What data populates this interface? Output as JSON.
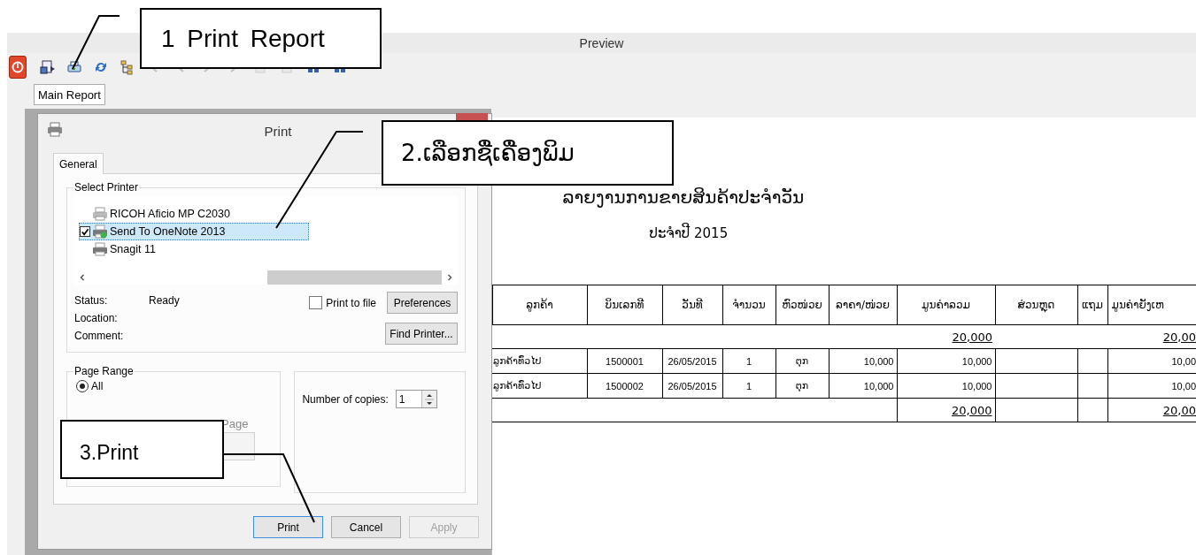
{
  "window": {
    "title": "Preview"
  },
  "toolbar": [
    {
      "kind": "power",
      "disabled": false
    },
    {
      "kind": "export",
      "disabled": false
    },
    {
      "kind": "print",
      "disabled": false
    },
    {
      "kind": "refresh",
      "disabled": false
    },
    {
      "kind": "tree",
      "disabled": false
    },
    {
      "kind": "first",
      "disabled": true
    },
    {
      "kind": "prev",
      "disabled": true
    },
    {
      "kind": "next",
      "disabled": true
    },
    {
      "kind": "last",
      "disabled": true
    },
    {
      "kind": "page",
      "disabled": true
    },
    {
      "kind": "page",
      "disabled": true
    },
    {
      "kind": "columns",
      "disabled": false
    },
    {
      "kind": "columns",
      "disabled": false
    }
  ],
  "report_tabs": [
    {
      "label": "Main Report",
      "selected": true
    }
  ],
  "print_dialog": {
    "title": "Print",
    "tabs": [
      {
        "label": "General",
        "selected": true
      }
    ],
    "select_printer": {
      "legend": "Select Printer",
      "printers": [
        {
          "name": "RICOH Aficio MP C2030",
          "selected": false,
          "default": false
        },
        {
          "name": "Send To OneNote 2013",
          "selected": true,
          "default": true
        },
        {
          "name": "Snagit 11",
          "selected": false,
          "default": false
        }
      ],
      "status_label": "Status:",
      "status": "Ready",
      "location_label": "Location:",
      "comment_label": "Comment:",
      "print_to_file": {
        "label": "Print to file",
        "checked": false
      },
      "preferences_button": "Preferences",
      "find_printer_button": "Find Printer..."
    },
    "page_range": {
      "legend": "Page Range",
      "all": {
        "label": "All",
        "selected": true
      },
      "hidden_option": {
        "label": "Page",
        "disabled": true
      }
    },
    "copies": {
      "label": "Number of copies:",
      "value": "1"
    },
    "buttons": [
      {
        "label": "Print",
        "kind": "default",
        "disabled": false
      },
      {
        "label": "Cancel",
        "kind": "normal",
        "disabled": false
      },
      {
        "label": "Apply",
        "kind": "normal",
        "disabled": true
      }
    ]
  },
  "report": {
    "title": "ລາຍງານການຂາຍສິນຄ້າປະຈຳວັນ",
    "subtitle": "ປະຈຳປີ 2015",
    "columns": [
      "ລູກຄ້າ",
      "ບິນເລກທີ",
      "ວັນທີ",
      "ຈຳນວນ",
      "ຫົວໜ່ວຍ",
      "ລາຄາ/ໜ່ວຍ",
      "ມູນຄ່າລວມ",
      "ສ່ວນຫຼຸດ",
      "ແຖມ",
      "ມູນຄ່າຍັງເຫ"
    ],
    "subtotal": {
      "amount": "20,000",
      "balance": "20,00"
    },
    "rows": [
      [
        "ລູກຄ້າທົ່ວໄປ",
        "1500001",
        "26/05/2015",
        "1",
        "ຕຸກ",
        "10,000",
        "10,000",
        "",
        "",
        "10,00"
      ],
      [
        "ລູກຄ້າທົ່ວໄປ",
        "1500002",
        "26/05/2015",
        "1",
        "ຕຸກ",
        "10,000",
        "10,000",
        "",
        "",
        "10,00"
      ]
    ],
    "total": {
      "amount": "20,000",
      "balance": "20,00"
    }
  },
  "callouts": [
    {
      "text": "1 Print Report"
    },
    {
      "text": "2.ເລືອກຊື່ເຄື່ອງພິມ"
    },
    {
      "text": "3.Print"
    }
  ]
}
